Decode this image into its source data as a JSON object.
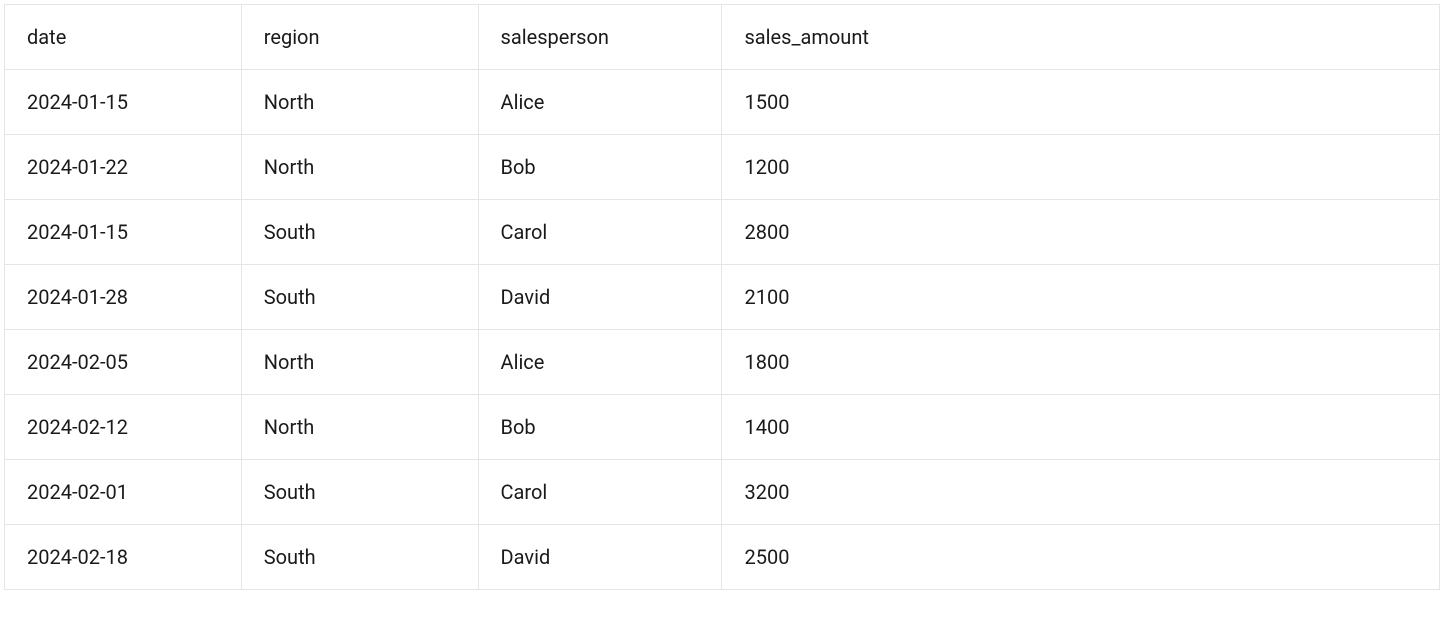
{
  "table": {
    "columns": [
      {
        "key": "date",
        "label": "date"
      },
      {
        "key": "region",
        "label": "region"
      },
      {
        "key": "salesperson",
        "label": "salesperson"
      },
      {
        "key": "sales_amount",
        "label": "sales_amount"
      }
    ],
    "rows": [
      {
        "date": "2024-01-15",
        "region": "North",
        "salesperson": "Alice",
        "sales_amount": "1500"
      },
      {
        "date": "2024-01-22",
        "region": "North",
        "salesperson": "Bob",
        "sales_amount": "1200"
      },
      {
        "date": "2024-01-15",
        "region": "South",
        "salesperson": "Carol",
        "sales_amount": "2800"
      },
      {
        "date": "2024-01-28",
        "region": "South",
        "salesperson": "David",
        "sales_amount": "2100"
      },
      {
        "date": "2024-02-05",
        "region": "North",
        "salesperson": "Alice",
        "sales_amount": "1800"
      },
      {
        "date": "2024-02-12",
        "region": "North",
        "salesperson": "Bob",
        "sales_amount": "1400"
      },
      {
        "date": "2024-02-01",
        "region": "South",
        "salesperson": "Carol",
        "sales_amount": "3200"
      },
      {
        "date": "2024-02-18",
        "region": "South",
        "salesperson": "David",
        "sales_amount": "2500"
      }
    ]
  }
}
